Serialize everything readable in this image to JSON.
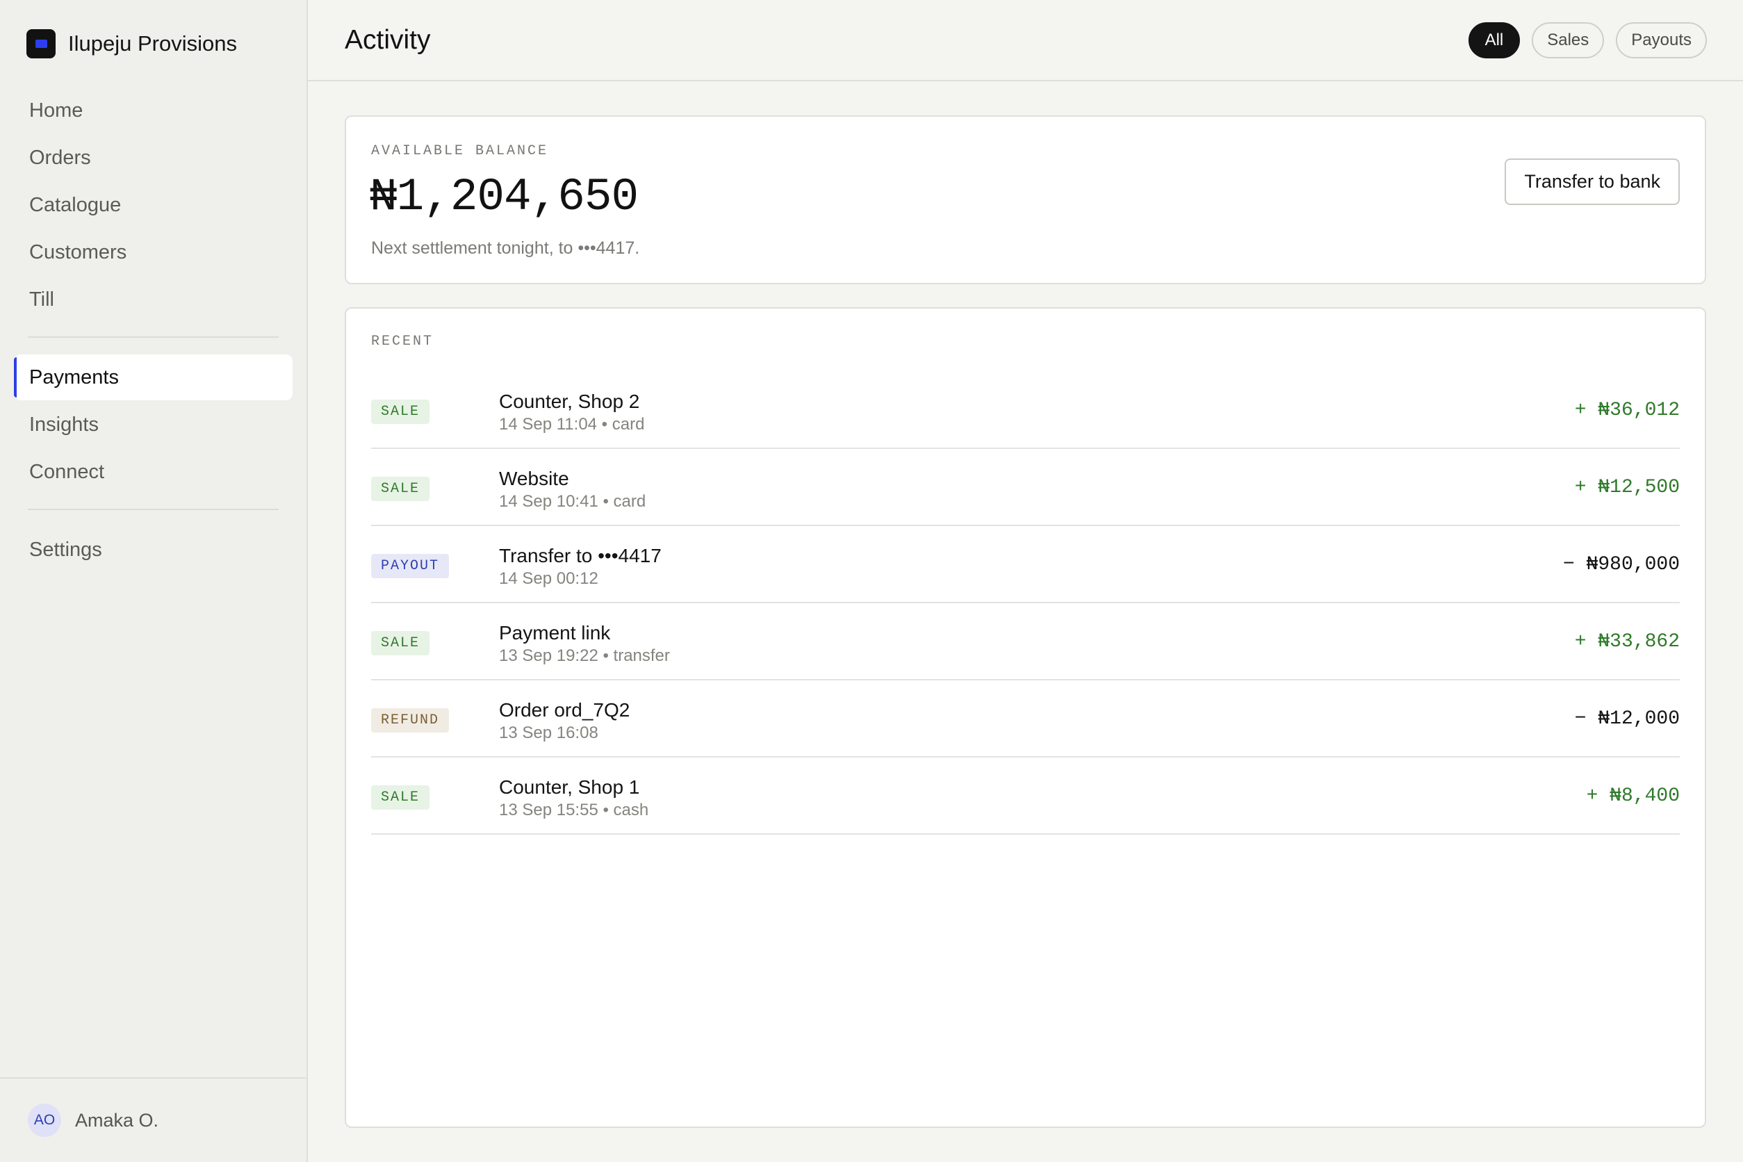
{
  "brand": {
    "name": "Ilupeju Provisions"
  },
  "nav": {
    "primary": [
      "Home",
      "Orders",
      "Catalogue",
      "Customers",
      "Till"
    ],
    "secondary": [
      "Payments",
      "Insights",
      "Connect"
    ],
    "tertiary": [
      "Settings"
    ],
    "active": "Payments"
  },
  "user": {
    "initials": "AO",
    "name": "Amaka O."
  },
  "header": {
    "title": "Activity",
    "filters": [
      "All",
      "Sales",
      "Payouts"
    ],
    "active_filter": "All"
  },
  "balance": {
    "label": "AVAILABLE BALANCE",
    "amount": "₦1,204,650",
    "note": "Next settlement tonight, to •••4417.",
    "action_label": "Transfer to bank"
  },
  "recent": {
    "label": "RECENT",
    "transactions": [
      {
        "type": "SALE",
        "kind": "sale",
        "title": "Counter, Shop 2",
        "meta": "14 Sep 11:04 • card",
        "amount": "+ ₦36,012",
        "direction": "credit"
      },
      {
        "type": "SALE",
        "kind": "sale",
        "title": "Website",
        "meta": "14 Sep 10:41 • card",
        "amount": "+ ₦12,500",
        "direction": "credit"
      },
      {
        "type": "PAYOUT",
        "kind": "payout",
        "title": "Transfer to •••4417",
        "meta": "14 Sep 00:12",
        "amount": "− ₦980,000",
        "direction": "debit"
      },
      {
        "type": "SALE",
        "kind": "sale",
        "title": "Payment link",
        "meta": "13 Sep 19:22 • transfer",
        "amount": "+ ₦33,862",
        "direction": "credit"
      },
      {
        "type": "REFUND",
        "kind": "refund",
        "title": "Order ord_7Q2",
        "meta": "13 Sep 16:08",
        "amount": "− ₦12,000",
        "direction": "debit"
      },
      {
        "type": "SALE",
        "kind": "sale",
        "title": "Counter, Shop 1",
        "meta": "13 Sep 15:55 • cash",
        "amount": "+ ₦8,400",
        "direction": "credit"
      }
    ]
  },
  "colors": {
    "accent": "#2c3fe6",
    "credit": "#2f7a2a",
    "background": "#f4f4f1",
    "sidebar": "#efefeb"
  },
  "icons": {
    "brand": "brand-logo-icon"
  }
}
